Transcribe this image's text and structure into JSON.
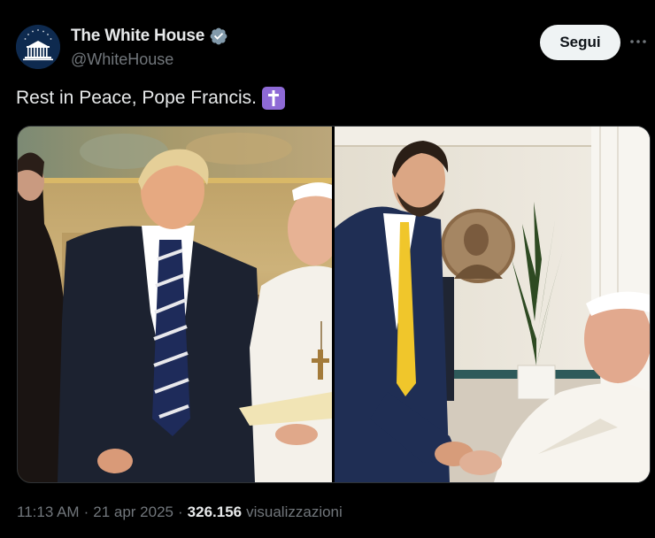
{
  "author": {
    "display_name": "The White House",
    "handle": "@WhiteHouse",
    "avatar_icon": "white-house-logo",
    "verified_icon": "verified-badge-icon",
    "verified_color": "#1d9bf0"
  },
  "actions": {
    "follow_label": "Segui",
    "more_icon": "more-icon"
  },
  "post": {
    "text": "Rest in Peace, Pope Francis.",
    "emoji_icon": "latin-cross-emoji"
  },
  "media": {
    "left_photo": "photo-trump-with-pope",
    "right_photo": "photo-vance-with-pope"
  },
  "meta": {
    "time": "11:13 AM",
    "separator": "·",
    "date": "21 apr 2025",
    "views_count": "326.156",
    "views_label": "visualizzazioni"
  },
  "colors": {
    "background": "#000000",
    "text_primary": "#e7e9ea",
    "text_secondary": "#71767b",
    "button_bg": "#eff3f4",
    "emoji_purple": "#8e6ad6"
  }
}
